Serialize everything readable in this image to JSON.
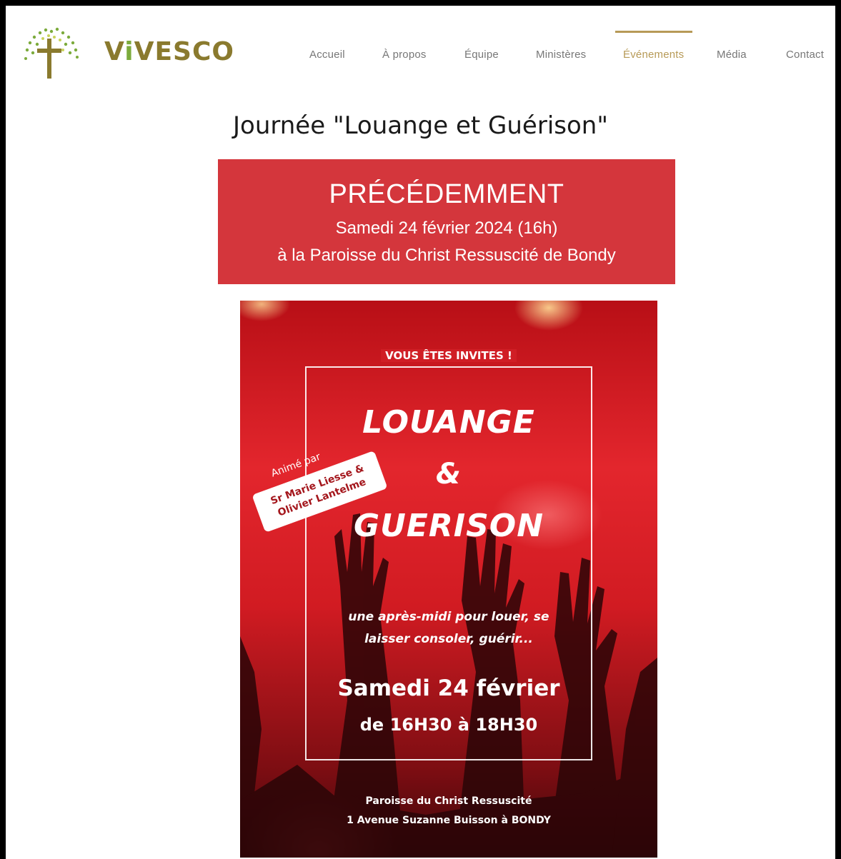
{
  "header": {
    "brand": {
      "name_prefix": "V",
      "name_accent": "i",
      "name_suffix": "VESCO"
    },
    "nav": [
      {
        "label": "Accueil"
      },
      {
        "label": "À propos"
      },
      {
        "label": "Équipe"
      },
      {
        "label": "Ministères"
      },
      {
        "label": "Événements",
        "active": true
      },
      {
        "label": "Média"
      },
      {
        "label": "Contact"
      }
    ]
  },
  "page": {
    "title": "Journée \"Louange et Guérison\""
  },
  "banner": {
    "status": "PRÉCÉDEMMENT",
    "date": "Samedi 24 février 2024 (16h)",
    "place": "à la Paroisse du Christ Ressuscité de Bondy",
    "color": "#d4363c"
  },
  "poster": {
    "invite": "VOUS ÊTES INVITES !",
    "title_line1": "LOUANGE",
    "title_amp": "&",
    "title_line2": "GUERISON",
    "animated_by": "Animé par",
    "hosts_line1": "Sr Marie Liesse &",
    "hosts_line2": "Olivier Lantelme",
    "tagline_line1": "une après-midi pour louer, se",
    "tagline_line2": "laisser consoler, guérir...",
    "date": "Samedi 24 février",
    "hours": "de 16H30 à 18H30",
    "venue_line1": "Paroisse du Christ Ressuscité",
    "venue_line2": "1 Avenue Suzanne Buisson à BONDY"
  },
  "colors": {
    "accent_gold": "#b79a57",
    "brand_olive": "#8a7a2e",
    "brand_green": "#7cab3c",
    "poster_red": "#d11b22"
  }
}
